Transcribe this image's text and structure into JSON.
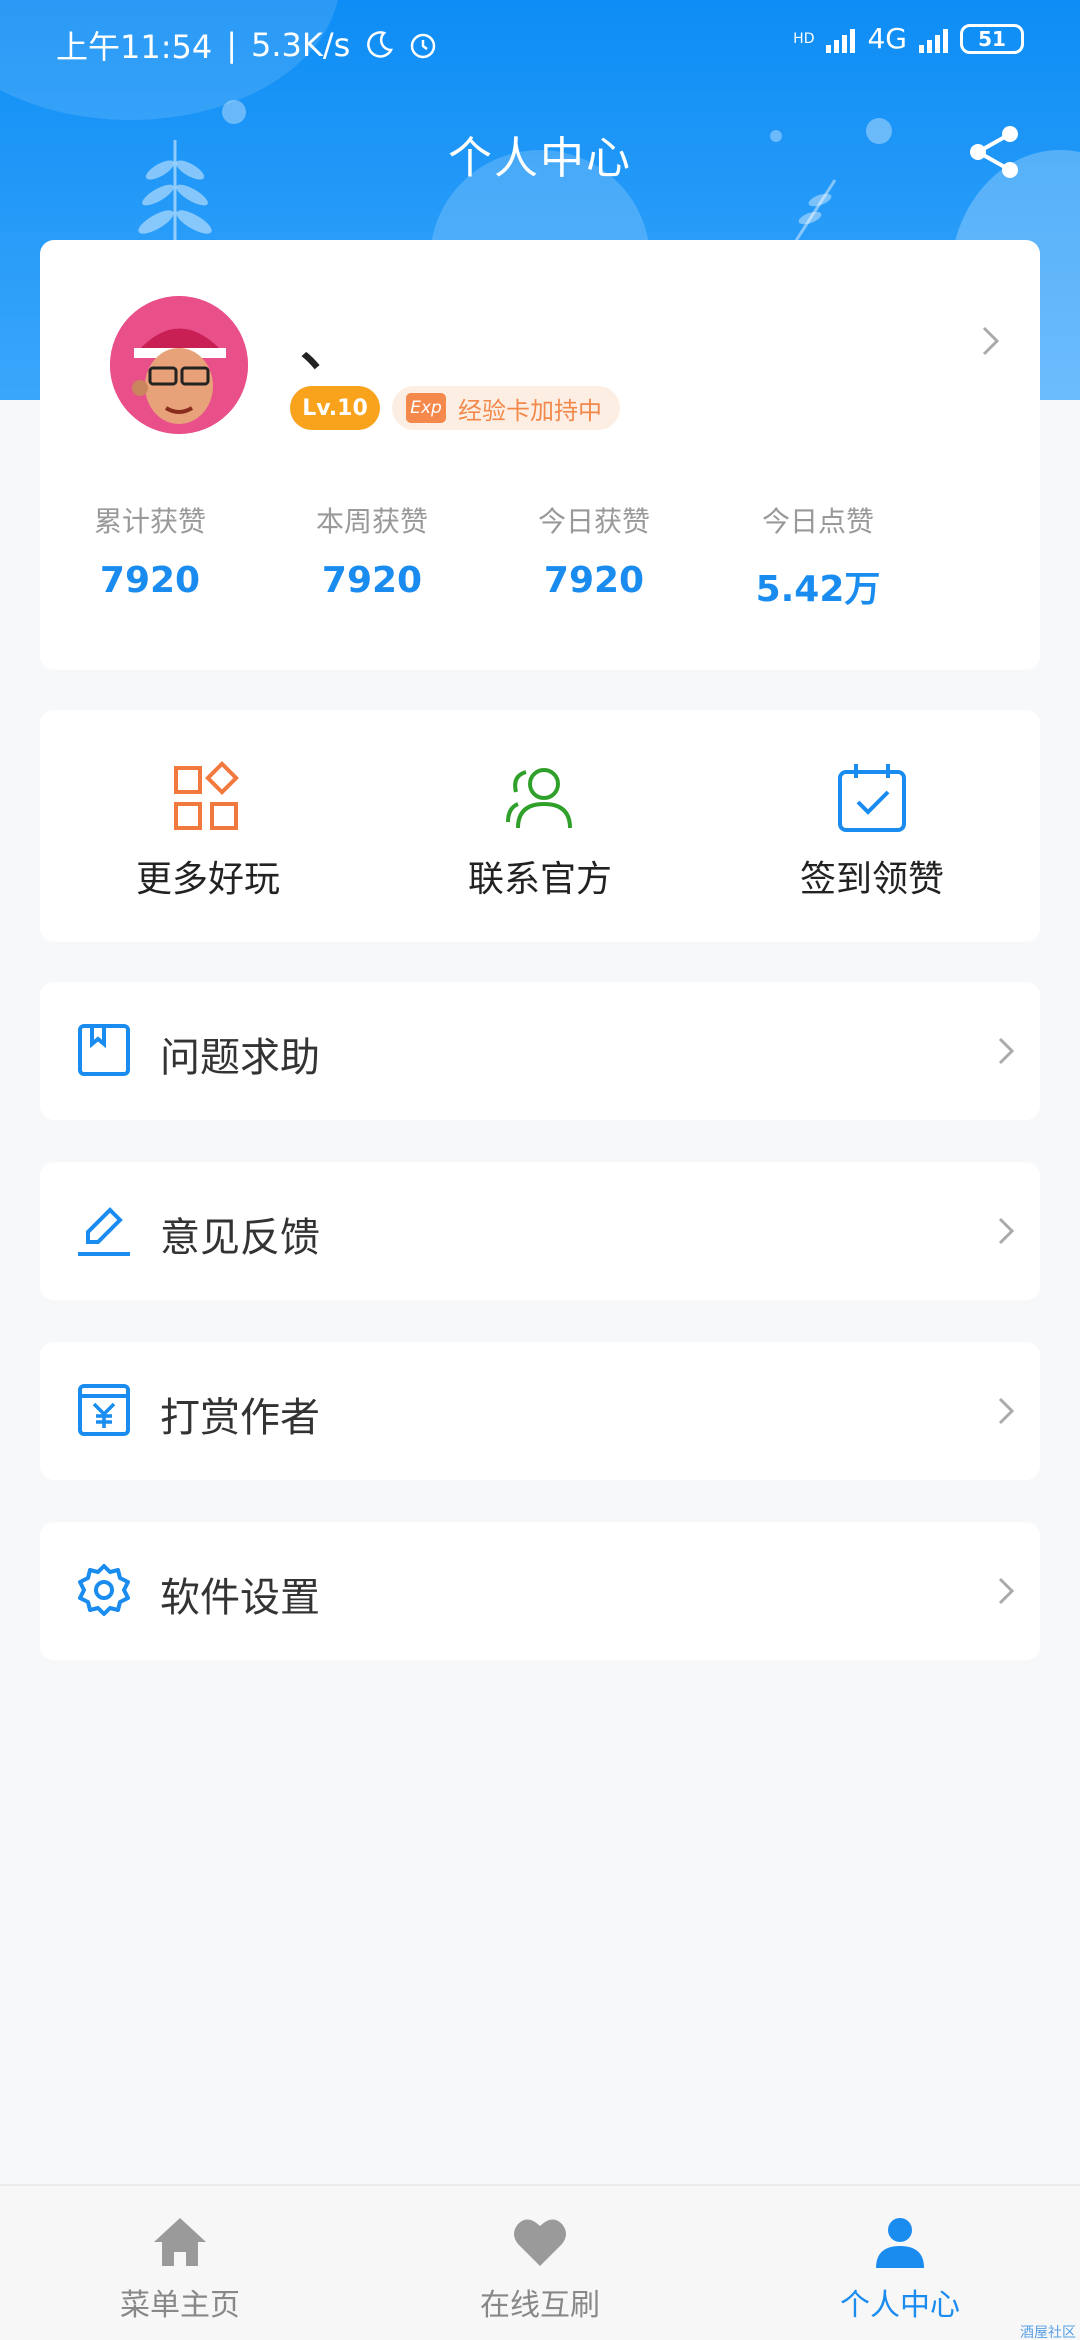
{
  "status_bar": {
    "time": "上午11:54",
    "net_speed": "5.3K/s",
    "network": "4G",
    "hd": "HD",
    "battery": "51"
  },
  "header": {
    "title": "个人中心"
  },
  "profile": {
    "username": "、",
    "level": "Lv.10",
    "exp_icon_text": "Exp",
    "exp_status": "经验卡加持中",
    "stats": [
      {
        "label": "累计获赞",
        "value": "7920"
      },
      {
        "label": "本周获赞",
        "value": "7920"
      },
      {
        "label": "今日获赞",
        "value": "7920"
      },
      {
        "label": "今日点赞",
        "value": "5.42万"
      }
    ]
  },
  "quick_actions": [
    {
      "label": "更多好玩",
      "icon": "grid-apps-icon",
      "color": "#f2793d"
    },
    {
      "label": "联系官方",
      "icon": "users-icon",
      "color": "#2fa12a"
    },
    {
      "label": "签到领赞",
      "icon": "calendar-check-icon",
      "color": "#1a8cf0"
    }
  ],
  "menu": [
    {
      "label": "问题求助",
      "icon": "help-book-icon"
    },
    {
      "label": "意见反馈",
      "icon": "edit-pen-icon"
    },
    {
      "label": "打赏作者",
      "icon": "yuan-reward-icon"
    },
    {
      "label": "软件设置",
      "icon": "gear-icon"
    }
  ],
  "bottom_nav": [
    {
      "label": "菜单主页",
      "icon": "home-icon",
      "active": false
    },
    {
      "label": "在线互刷",
      "icon": "heart-icon",
      "active": false
    },
    {
      "label": "个人中心",
      "icon": "person-icon",
      "active": true
    }
  ],
  "watermark": "酒屋社区",
  "colors": {
    "primary": "#1a8cf0",
    "orange": "#f9a21b",
    "green": "#2fa12a",
    "coral": "#f2793d"
  }
}
